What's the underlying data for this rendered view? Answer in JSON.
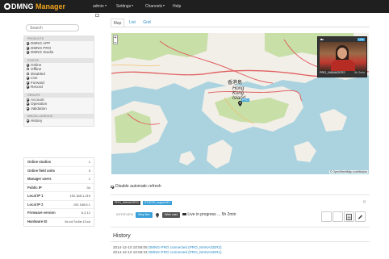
{
  "app": {
    "brand_prefix": "DMNG",
    "brand_suffix": "Manager",
    "accent_color": "#f0a31b"
  },
  "nav": {
    "items": [
      {
        "label": "admin",
        "has_caret": true
      },
      {
        "label": "Settings",
        "has_caret": true
      },
      {
        "label": "Channels",
        "has_caret": true
      },
      {
        "label": "Help",
        "has_caret": false
      }
    ]
  },
  "sidebar": {
    "search_placeholder": "Search",
    "sections": [
      {
        "title": "PRODUCTS",
        "items": [
          {
            "label": "DMNG APP",
            "checked": true
          },
          {
            "label": "DMNG PRO",
            "checked": true
          },
          {
            "label": "DMNG Studio",
            "checked": true
          }
        ]
      },
      {
        "title": "STATUS",
        "items": [
          {
            "label": "Online",
            "checked": true
          },
          {
            "label": "Offline",
            "checked": false
          },
          {
            "label": "Disabled",
            "checked": false
          },
          {
            "label": "Live",
            "checked": true
          },
          {
            "label": "Forward",
            "checked": true
          },
          {
            "label": "Record",
            "checked": true
          }
        ]
      },
      {
        "title": "GROUPS",
        "items": [
          {
            "label": "Account",
            "checked": true
          },
          {
            "label": "Operation",
            "checked": true
          },
          {
            "label": "Validation",
            "checked": true
          }
        ]
      },
      {
        "title": "MISCELLANEOUS",
        "items": [
          {
            "label": "History",
            "checked": true
          }
        ]
      }
    ],
    "stats": [
      {
        "label": "Online studios",
        "value": "1"
      },
      {
        "label": "Online field units",
        "value": "3"
      },
      {
        "label": "Manager users",
        "value": "1"
      },
      {
        "label": "Public IP",
        "value": ".34"
      },
      {
        "label": "Local IP 1",
        "value": "192.168.1.219"
      },
      {
        "label": "Local IP 2",
        "value": "192.168.6.1"
      },
      {
        "label": "Firmware version",
        "value": "6.2.12"
      },
      {
        "label": "Hardware ID",
        "value": "8c:c4:7a:6e:13:cd"
      }
    ]
  },
  "tabs": [
    {
      "label": "Map",
      "active": true
    },
    {
      "label": "List",
      "active": false
    },
    {
      "label": "Grid",
      "active": false
    }
  ],
  "map": {
    "zoom_in": "+",
    "zoom_out": "−",
    "labels": {
      "hong_kong_zh": "香港島",
      "hong_kong_line1": "Hong",
      "hong_kong_line2": "Kong",
      "hong_kong_line3": "Island"
    },
    "pin_label": "PRO",
    "attribution": "© OpenStreetMap contributors",
    "camera_card": {
      "live_badge": "Live",
      "name": "PRO_MANAGER2",
      "duration": "5h 2min",
      "camera_icon": "video-camera-icon"
    },
    "colors": {
      "water": "#aad3df",
      "land": "#f2efe9",
      "green": "#c8dfa8",
      "road": "#e06060"
    }
  },
  "refresh": {
    "label": "Disable automatic refresh",
    "checked": true
  },
  "session": {
    "device_badge": "PRO_MANAGER2",
    "studio_badge": "STUDIO_support13",
    "mode_label": "INTERVIEW",
    "stop_live_label": "Stop live",
    "web_cast_label": "Web cast",
    "status_text": "Live in progress ... 5h 2min",
    "colors": {
      "device": "#444444",
      "studio": "#3aa0d8",
      "stop": "#3aa0d8",
      "web": "#555555"
    }
  },
  "history": {
    "title": "History",
    "entries": [
      {
        "time": "2014-12-10 10:56:05",
        "link_text": "DMNG-PRO connected (PRO_MANAGER2)"
      },
      {
        "time": "2014-12-10 10:56:34",
        "link_text": "DMNG-PRO connected (PRO_MANAGER1)"
      }
    ]
  }
}
